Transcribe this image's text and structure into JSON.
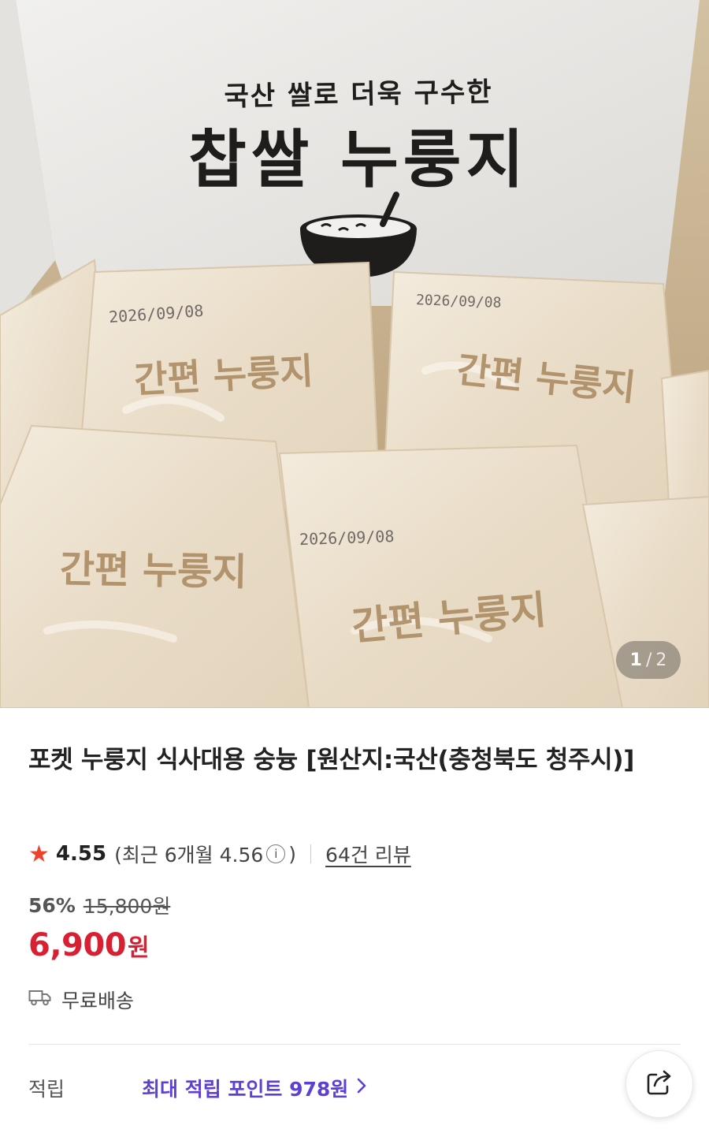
{
  "image": {
    "box_tagline": "국산 쌀로 더욱 구수한",
    "box_title": "찹쌀 누룽지",
    "pack_label": "간편 누룽지",
    "pack_date": "2026/09/08",
    "counter": {
      "current": "1",
      "separator": "/",
      "total": "2"
    }
  },
  "product": {
    "title": "포켓 누룽지 식사대용 숭늉 [원산지:국산(충청북도 청주시)]",
    "rating": {
      "star_icon": "star-icon",
      "score": "4.55",
      "recent_prefix": "(최근 6개월 4.56",
      "recent_suffix": ")",
      "info_icon": "info-icon",
      "reviews": "64건 리뷰"
    },
    "price": {
      "discount": "56%",
      "original": "15,800원",
      "sale_amount": "6,900",
      "sale_unit": "원",
      "accent_color": "#d91f32"
    },
    "shipping": {
      "icon": "truck-icon",
      "label": "무료배송"
    },
    "points": {
      "label": "적립",
      "value": "최대 적립 포인트 978원",
      "accent_color": "#5d3fd3"
    }
  },
  "actions": {
    "share_icon": "share-icon"
  }
}
